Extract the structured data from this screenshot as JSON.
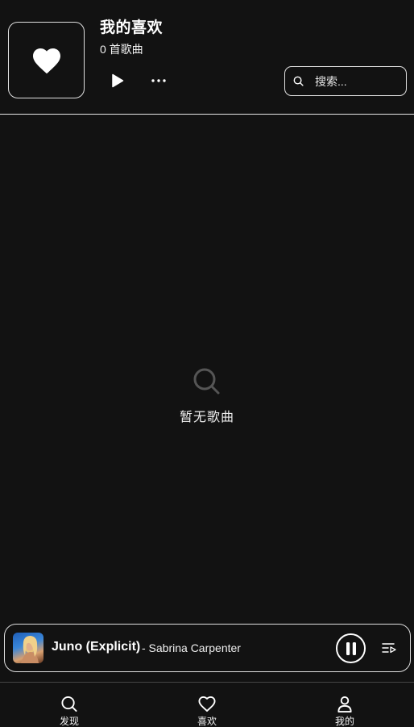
{
  "playlist": {
    "title": "我的喜欢",
    "song_count": "0 首歌曲",
    "cover_icon": "heart-icon"
  },
  "actions": {
    "play_icon": "play-icon",
    "more_icon": "more-icon"
  },
  "search": {
    "placeholder": "搜索...",
    "value": ""
  },
  "empty_state": {
    "icon": "search-icon",
    "label": "暂无歌曲"
  },
  "now_playing": {
    "song": "Juno (Explicit)",
    "artist": "- Sabrina Carpenter",
    "state": "playing",
    "pause_icon": "pause-icon",
    "queue_icon": "queue-icon"
  },
  "nav": {
    "items": [
      {
        "label": "发现",
        "icon": "search-icon"
      },
      {
        "label": "喜欢",
        "icon": "heart-icon"
      },
      {
        "label": "我的",
        "icon": "user-icon"
      }
    ]
  },
  "colors": {
    "background": "#121212",
    "foreground": "#ffffff",
    "border": "#e0e0e0",
    "muted_icon": "#555555"
  }
}
